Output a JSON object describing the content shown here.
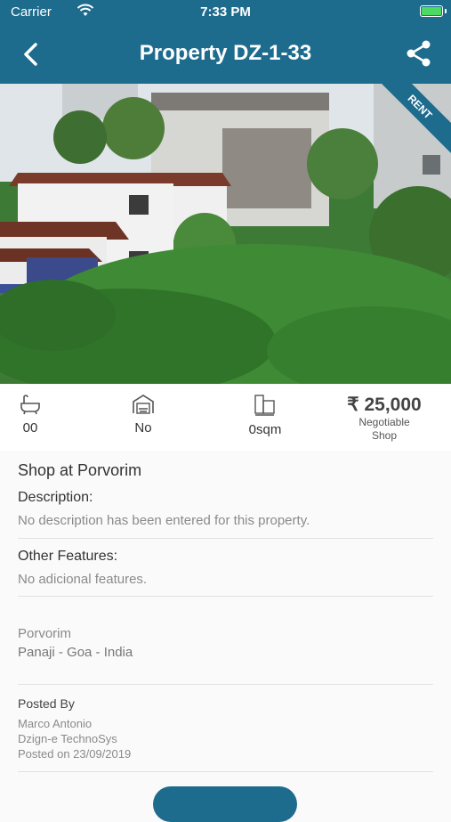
{
  "status_bar": {
    "carrier": "Carrier",
    "time": "7:33 PM"
  },
  "nav": {
    "title": "Property DZ-1-33"
  },
  "photo": {
    "badge": "RENT"
  },
  "stats": {
    "bathrooms": "00",
    "garage": "No",
    "area": "0sqm",
    "price": "₹ 25,000",
    "price_note": "Negotiable",
    "type": "Shop"
  },
  "details": {
    "heading": "Shop at Porvorim",
    "description_label": "Description:",
    "description": "No description has been entered for this property.",
    "features_label": "Other Features:",
    "features": "No adicional features.",
    "locality": "Porvorim",
    "region": "Panaji - Goa - India",
    "posted_label": "Posted By",
    "posted_name": "Marco Antonio",
    "posted_company": "Dzign-e TechnoSys",
    "posted_date": "Posted on 23/09/2019"
  },
  "colors": {
    "primary": "#1d6b8d",
    "text": "#333333",
    "muted": "#8a8a8a"
  }
}
